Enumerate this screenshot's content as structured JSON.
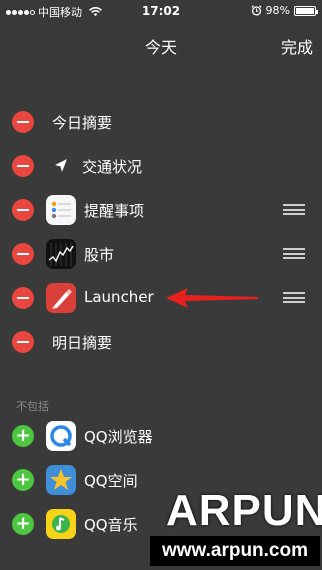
{
  "status_bar": {
    "carrier": "中国移动",
    "time": "17:02",
    "battery": "98%",
    "battery_level": 0.98,
    "signal_bars": 4
  },
  "nav": {
    "title": "今天",
    "done_label": "完成"
  },
  "enabled_widgets": [
    {
      "label": "今日摘要",
      "icon": "none",
      "reorderable": false
    },
    {
      "label": "交通状况",
      "icon": "location-arrow-icon",
      "reorderable": false
    },
    {
      "label": "提醒事项",
      "icon": "reminders-icon",
      "reorderable": true
    },
    {
      "label": "股市",
      "icon": "stocks-icon",
      "reorderable": true
    },
    {
      "label": "Launcher",
      "icon": "launcher-icon",
      "reorderable": true
    },
    {
      "label": "明日摘要",
      "icon": "none",
      "reorderable": false
    }
  ],
  "available_header": "不包括",
  "available_widgets": [
    {
      "label": "QQ浏览器",
      "icon": "qq-browser-icon"
    },
    {
      "label": "QQ空间",
      "icon": "qzone-icon"
    },
    {
      "label": "QQ音乐",
      "icon": "qq-music-icon"
    }
  ],
  "watermark": {
    "brand": "ARPUN",
    "url": "www.arpun.com"
  },
  "colors": {
    "remove": "#e8463e",
    "add": "#4cc73f",
    "background": "#3a3a3a",
    "annotation_arrow": "#e8201e"
  }
}
